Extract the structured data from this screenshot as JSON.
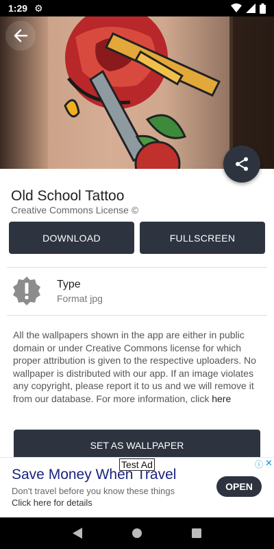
{
  "status": {
    "time": "1:29"
  },
  "wallpaper": {
    "title": "Old School Tattoo",
    "license": "Creative Commons License ©",
    "download_label": "DOWNLOAD",
    "fullscreen_label": "FULLSCREEN",
    "type_label": "Type",
    "type_value": "Format jpg",
    "info_text": "All the wallpapers shown in the app are either in public domain or under Creative Commons license for which proper attribution is given to the respective uploaders. No wallpaper is distributed with our app. If an image violates any copyright, please report it to us and we will remove it from our database. For more information, click ",
    "info_link": "here",
    "set_wallpaper_label": "SET AS WALLPAPER"
  },
  "ad": {
    "tag": "Test Ad",
    "headline": "Save Money When Travel",
    "body": "Don't travel before you know these things",
    "cta_text": "Click here for details",
    "open_label": "OPEN"
  },
  "icons": {
    "back": "arrow-left-icon",
    "share": "share-icon",
    "type": "alert-badge-icon",
    "settings": "gear-icon"
  },
  "colors": {
    "primary_dark": "#2d3440",
    "ad_headline": "#1a237e",
    "ad_choices": "#1a8fd6"
  }
}
